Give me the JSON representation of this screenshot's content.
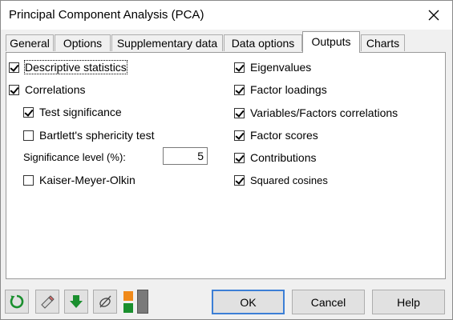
{
  "window": {
    "title": "Principal Component Analysis (PCA)"
  },
  "tabs": [
    {
      "label": "General"
    },
    {
      "label": "Options"
    },
    {
      "label": "Supplementary data"
    },
    {
      "label": "Data options"
    },
    {
      "label": "Outputs",
      "active": true
    },
    {
      "label": "Charts"
    }
  ],
  "outputs": {
    "left": {
      "descriptive_statistics": {
        "label": "Descriptive statistics",
        "checked": true
      },
      "correlations": {
        "label": "Correlations",
        "checked": true
      },
      "test_significance": {
        "label": "Test significance",
        "checked": true
      },
      "bartlett": {
        "label": "Bartlett's sphericity test",
        "checked": false
      },
      "significance_level": {
        "label": "Significance level (%):",
        "value": "5"
      },
      "kmo": {
        "label": "Kaiser-Meyer-Olkin",
        "checked": false
      }
    },
    "right": {
      "eigenvalues": {
        "label": "Eigenvalues",
        "checked": true
      },
      "factor_loadings": {
        "label": "Factor loadings",
        "checked": true
      },
      "var_factor_corr": {
        "label": "Variables/Factors correlations",
        "checked": true
      },
      "factor_scores": {
        "label": "Factor scores",
        "checked": true
      },
      "contributions": {
        "label": "Contributions",
        "checked": true
      },
      "squared_cosines": {
        "label": "Squared cosines",
        "checked": true
      }
    }
  },
  "buttons": {
    "ok": "OK",
    "cancel": "Cancel",
    "help": "Help"
  },
  "toolbar_icons": [
    "reset-icon",
    "eraser-icon",
    "download-arrow-icon",
    "clear-selection-icon",
    "orange-green-blocks-icon"
  ],
  "colors": {
    "accent_focus": "#3c7fd6",
    "green_icon": "#1a8f2e",
    "orange_block": "#f08a1a"
  }
}
